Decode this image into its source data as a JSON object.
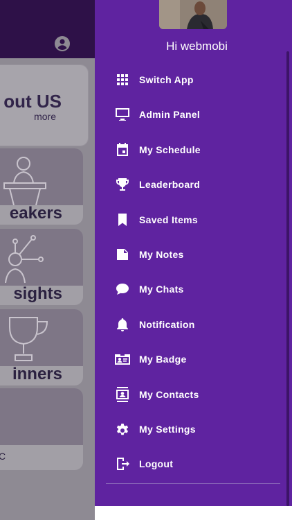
{
  "background": {
    "about_title": "out US",
    "about_sub": "more",
    "tiles": [
      {
        "label": "eakers"
      },
      {
        "label": "sights"
      },
      {
        "label": "inners"
      },
      {
        "label": ""
      }
    ],
    "bottom_char": "C"
  },
  "drawer": {
    "greeting": "Hi webmobi",
    "items": [
      {
        "label": "Switch App",
        "icon": "grid-icon"
      },
      {
        "label": "Admin Panel",
        "icon": "monitor-icon"
      },
      {
        "label": "My Schedule",
        "icon": "calendar-icon"
      },
      {
        "label": "Leaderboard",
        "icon": "trophy-icon"
      },
      {
        "label": "Saved Items",
        "icon": "bookmark-icon"
      },
      {
        "label": "My Notes",
        "icon": "note-icon"
      },
      {
        "label": "My Chats",
        "icon": "chat-bubble-icon"
      },
      {
        "label": "Notification",
        "icon": "bell-icon"
      },
      {
        "label": "My Badge",
        "icon": "badge-icon"
      },
      {
        "label": "My Contacts",
        "icon": "contacts-icon"
      },
      {
        "label": "My Settings",
        "icon": "gear-icon"
      },
      {
        "label": "Logout",
        "icon": "logout-icon"
      }
    ]
  },
  "colors": {
    "drawer": "#5f23a0",
    "header": "#2e1148",
    "overlay": "#8e8a93"
  }
}
